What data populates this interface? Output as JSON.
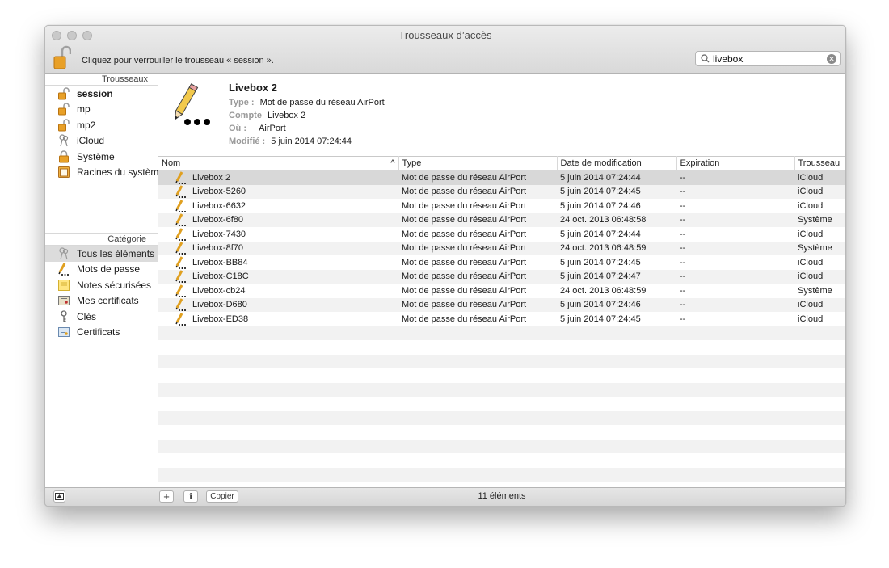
{
  "window": {
    "title": "Trousseaux d’accès",
    "lock_message": "Cliquez pour verrouiller le trousseau « session ».",
    "search_value": "livebox"
  },
  "sidebar": {
    "keychains_header": "Trousseaux",
    "keychains": [
      {
        "label": "session",
        "icon": "open-lock-icon",
        "bold": true
      },
      {
        "label": "mp",
        "icon": "open-lock-icon"
      },
      {
        "label": "mp2",
        "icon": "open-lock-icon"
      },
      {
        "label": "iCloud",
        "icon": "keys-icon"
      },
      {
        "label": "Système",
        "icon": "closed-lock-icon"
      },
      {
        "label": "Racines du système",
        "icon": "cabinet-icon"
      }
    ],
    "category_header": "Catégorie",
    "categories": [
      {
        "label": "Tous les éléments",
        "icon": "all-items-icon",
        "selected": true
      },
      {
        "label": "Mots de passe",
        "icon": "password-pencil-icon"
      },
      {
        "label": "Notes sécurisées",
        "icon": "secure-note-icon"
      },
      {
        "label": "Mes certificats",
        "icon": "my-certificates-icon"
      },
      {
        "label": "Clés",
        "icon": "key-icon"
      },
      {
        "label": "Certificats",
        "icon": "certificate-icon"
      }
    ]
  },
  "detail": {
    "name": "Livebox 2",
    "type_label": "Type :",
    "type_value": "Mot de passe du réseau AirPort",
    "account_label": "Compte",
    "account_value": "Livebox 2",
    "where_label": "Où :",
    "where_value": "AirPort",
    "modified_label": "Modifié :",
    "modified_value": "5 juin 2014 07:24:44"
  },
  "table": {
    "columns": [
      "Nom",
      "Type",
      "Date de modification",
      "Expiration",
      "Trousseau"
    ],
    "rows": [
      {
        "name": "Livebox 2",
        "type": "Mot de passe du réseau AirPort",
        "date": "5 juin 2014 07:24:44",
        "exp": "--",
        "keychain": "iCloud"
      },
      {
        "name": "Livebox-5260",
        "type": "Mot de passe du réseau AirPort",
        "date": "5 juin 2014 07:24:45",
        "exp": "--",
        "keychain": "iCloud"
      },
      {
        "name": "Livebox-6632",
        "type": "Mot de passe du réseau AirPort",
        "date": "5 juin 2014 07:24:46",
        "exp": "--",
        "keychain": "iCloud"
      },
      {
        "name": "Livebox-6f80",
        "type": "Mot de passe du réseau AirPort",
        "date": "24 oct. 2013 06:48:58",
        "exp": "--",
        "keychain": "Système"
      },
      {
        "name": "Livebox-7430",
        "type": "Mot de passe du réseau AirPort",
        "date": "5 juin 2014 07:24:44",
        "exp": "--",
        "keychain": "iCloud"
      },
      {
        "name": "Livebox-8f70",
        "type": "Mot de passe du réseau AirPort",
        "date": "24 oct. 2013 06:48:59",
        "exp": "--",
        "keychain": "Système"
      },
      {
        "name": "Livebox-BB84",
        "type": "Mot de passe du réseau AirPort",
        "date": "5 juin 2014 07:24:45",
        "exp": "--",
        "keychain": "iCloud"
      },
      {
        "name": "Livebox-C18C",
        "type": "Mot de passe du réseau AirPort",
        "date": "5 juin 2014 07:24:47",
        "exp": "--",
        "keychain": "iCloud"
      },
      {
        "name": "Livebox-cb24",
        "type": "Mot de passe du réseau AirPort",
        "date": "24 oct. 2013 06:48:59",
        "exp": "--",
        "keychain": "Système"
      },
      {
        "name": "Livebox-D680",
        "type": "Mot de passe du réseau AirPort",
        "date": "5 juin 2014 07:24:46",
        "exp": "--",
        "keychain": "iCloud"
      },
      {
        "name": "Livebox-ED38",
        "type": "Mot de passe du réseau AirPort",
        "date": "5 juin 2014 07:24:45",
        "exp": "--",
        "keychain": "iCloud"
      }
    ]
  },
  "bottom": {
    "add_label": "+",
    "info_label": "i",
    "copy_label": "Copier",
    "count": "11 éléments"
  }
}
